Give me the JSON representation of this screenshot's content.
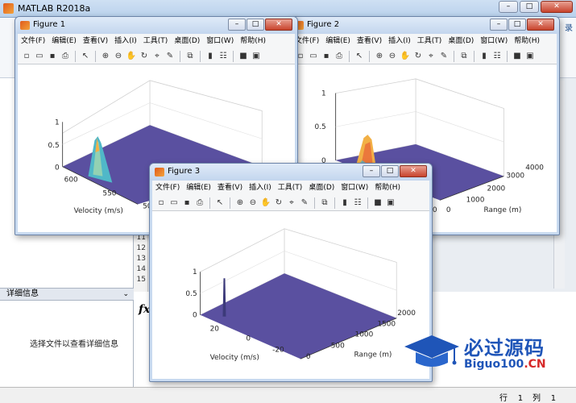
{
  "desktop": {
    "title": "MATLAB R2018a",
    "login_label": "录",
    "detail_header": "详细信息",
    "detail_text": "选择文件以查看详细信息",
    "line_numbers": [
      "11",
      "12",
      "13",
      "14",
      "15"
    ],
    "fx_glyph": "fx",
    "row_label": "行",
    "row_value": "1",
    "col_label": "列",
    "col_value": "1"
  },
  "menu": [
    "文件(F)",
    "编辑(E)",
    "查看(V)",
    "插入(I)",
    "工具(T)",
    "桌面(D)",
    "窗口(W)",
    "帮助(H)"
  ],
  "figures": {
    "fig1": {
      "title": "Figure 1",
      "z_ticks": [
        "1",
        "0.5",
        "0"
      ],
      "x_ticks": [
        "600",
        "550",
        "50"
      ],
      "xlabel": "Velocity (m/s)"
    },
    "fig2": {
      "title": "Figure 2",
      "z_ticks": [
        "1",
        "0.5",
        "0"
      ],
      "y_ticks": [
        "4000",
        "3000",
        "2000",
        "1000",
        "0"
      ],
      "x_ticks": [
        "0"
      ],
      "ylabel": "Range (m)"
    },
    "fig3": {
      "title": "Figure 3",
      "z_ticks": [
        "1",
        "0.5",
        "0"
      ],
      "x_ticks": [
        "20",
        "0",
        "-20"
      ],
      "y_ticks": [
        "2000",
        "1500",
        "1000",
        "500",
        "0"
      ],
      "xlabel": "Velocity (m/s)",
      "ylabel": "Range (m)"
    }
  },
  "colors": {
    "surface": "#5a50a0",
    "peak_hot": "#f5c04a",
    "peak_cool": "#3fb8c8"
  },
  "watermark": {
    "cn": "必过源码",
    "en_main": "Biguo100",
    "en_suffix": ".CN"
  }
}
